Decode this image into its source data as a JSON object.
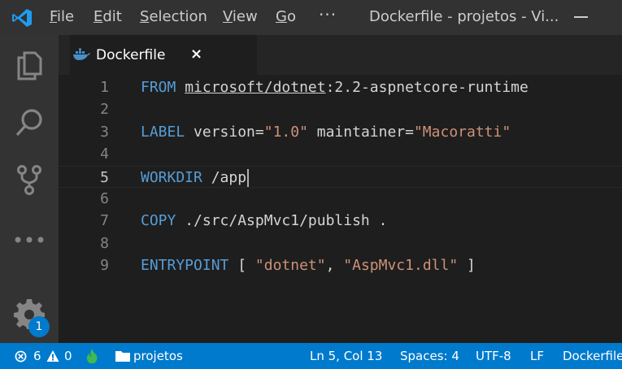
{
  "titlebar": {
    "menu": [
      {
        "label": "File",
        "mnemonic": "F",
        "rest": "ile"
      },
      {
        "label": "Edit",
        "mnemonic": "E",
        "rest": "dit"
      },
      {
        "label": "Selection",
        "mnemonic": "S",
        "rest": "election"
      },
      {
        "label": "View",
        "mnemonic": "V",
        "rest": "iew"
      },
      {
        "label": "Go",
        "mnemonic": "G",
        "rest": "o"
      }
    ],
    "more": "···",
    "window_title": "Dockerfile - projetos - Vi..."
  },
  "activity": {
    "icons": [
      "explorer-icon",
      "search-icon",
      "source-control-icon",
      "more-icon",
      "gear-icon"
    ],
    "settings_badge": "1"
  },
  "tab": {
    "label": "Dockerfile",
    "close": "×",
    "icon": "docker-whale-icon"
  },
  "editor": {
    "current_line": 5,
    "lines": [
      {
        "n": "1",
        "tokens": [
          {
            "t": "FROM",
            "c": "kw"
          },
          {
            "t": " ",
            "c": ""
          },
          {
            "t": "microsoft/dotnet",
            "c": "ul"
          },
          {
            "t": ":2.2-aspnetcore-runtime",
            "c": ""
          }
        ]
      },
      {
        "n": "2",
        "tokens": []
      },
      {
        "n": "3",
        "tokens": [
          {
            "t": "LABEL",
            "c": "kw"
          },
          {
            "t": " version=",
            "c": ""
          },
          {
            "t": "\"1.0\"",
            "c": "str"
          },
          {
            "t": " maintainer=",
            "c": ""
          },
          {
            "t": "\"Macoratti\"",
            "c": "str"
          }
        ]
      },
      {
        "n": "4",
        "tokens": []
      },
      {
        "n": "5",
        "tokens": [
          {
            "t": "WORKDIR",
            "c": "kw"
          },
          {
            "t": " /app",
            "c": ""
          }
        ]
      },
      {
        "n": "6",
        "tokens": []
      },
      {
        "n": "7",
        "tokens": [
          {
            "t": "COPY",
            "c": "kw"
          },
          {
            "t": " ./src/AspMvc1/publish .",
            "c": ""
          }
        ]
      },
      {
        "n": "8",
        "tokens": []
      },
      {
        "n": "9",
        "tokens": [
          {
            "t": "ENTRYPOINT",
            "c": "kw"
          },
          {
            "t": " [ ",
            "c": ""
          },
          {
            "t": "\"dotnet\"",
            "c": "str"
          },
          {
            "t": ", ",
            "c": ""
          },
          {
            "t": "\"AspMvc1.dll\"",
            "c": "str"
          },
          {
            "t": " ]",
            "c": ""
          }
        ]
      }
    ]
  },
  "statusbar": {
    "errors": "6",
    "warnings": "0",
    "folder": "projetos",
    "position": "Ln 5, Col 13",
    "spaces": "Spaces: 4",
    "encoding": "UTF-8",
    "eol": "LF",
    "language": "Dockerfile"
  },
  "colors": {
    "accent": "#007acc",
    "keyword": "#569cd6",
    "string": "#ce9178",
    "flame": "#3fb950"
  }
}
